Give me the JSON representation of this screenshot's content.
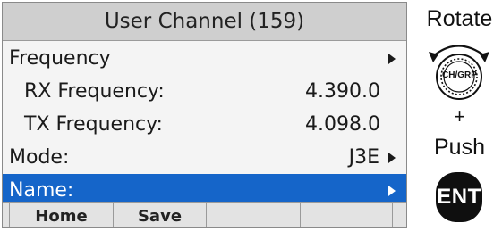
{
  "screen": {
    "title": "User Channel (159)",
    "rows": [
      {
        "label": "Frequency",
        "value": "",
        "arrow": true,
        "selected": false
      },
      {
        "label": "RX Frequency:",
        "value": "4.390.0",
        "arrow": false,
        "selected": false
      },
      {
        "label": "TX Frequency:",
        "value": "4.098.0",
        "arrow": false,
        "selected": false
      },
      {
        "label": "Mode:",
        "value": "J3E",
        "arrow": true,
        "selected": false
      },
      {
        "label": "Name:",
        "value": "",
        "arrow": true,
        "selected": true
      }
    ],
    "softkeys": [
      "Home",
      "Save",
      "",
      ""
    ],
    "colors": {
      "highlight": "#1565c9",
      "title_bar": "#cfcfcf",
      "background": "#f4f4f4"
    }
  },
  "controls": {
    "rotate_label": "Rotate",
    "knob_label": "CH/GRP",
    "plus_label": "+",
    "push_label": "Push",
    "ent_label": "ENT"
  }
}
